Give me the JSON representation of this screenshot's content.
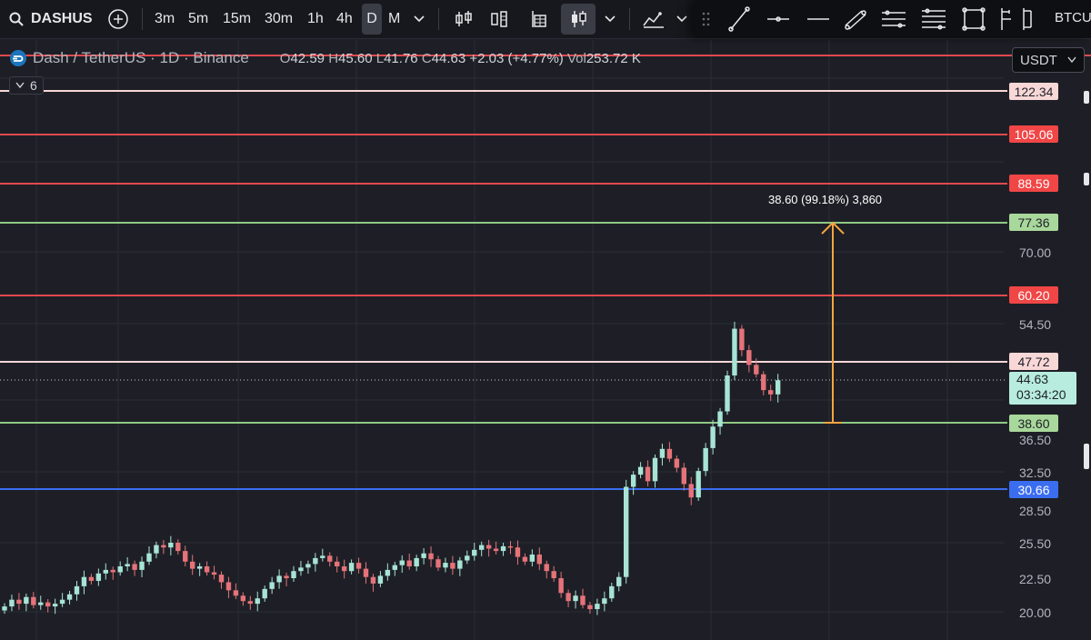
{
  "toolbar": {
    "symbol": "DASHUS",
    "timeframes": [
      "3m",
      "5m",
      "15m",
      "30m",
      "1h",
      "4h",
      "D",
      "M"
    ],
    "active_timeframe": "D",
    "right_text": "BTCU"
  },
  "legend": {
    "title": "Dash / TetherUS · 1D · Binance",
    "o_label": "O",
    "o": "42.59",
    "h_label": "H",
    "h": "45.60",
    "l_label": "L",
    "l": "41.76",
    "c_label": "C",
    "c": "44.63",
    "change": "+2.03 (+4.77%)",
    "vol_label": "Vol",
    "vol": "253.72 K",
    "indicator_count": "6"
  },
  "currency": "USDT",
  "axis_ticks": [
    "70.00",
    "54.50",
    "36.50",
    "32.50",
    "28.50",
    "25.50",
    "22.50",
    "20.00"
  ],
  "price_lines": [
    {
      "label": "122.34",
      "bg": "#f8d7d7",
      "fg": "#1e1f26",
      "line": "#f8d7d7"
    },
    {
      "label": "105.06",
      "bg": "#f04646",
      "fg": "#ffffff",
      "line": "#e04a4f"
    },
    {
      "label": "88.59",
      "bg": "#f04646",
      "fg": "#ffffff",
      "line": "#e04a4f"
    },
    {
      "label": "77.36",
      "bg": "#a8d89b",
      "fg": "#1e1f26",
      "line": "#8fc985"
    },
    {
      "label": "60.20",
      "bg": "#f04646",
      "fg": "#ffffff",
      "line": "#e04a4f"
    },
    {
      "label": "47.72",
      "bg": "#f8d7d7",
      "fg": "#1e1f26",
      "line": "#f8d7d7"
    },
    {
      "label": "38.60",
      "bg": "#a8d89b",
      "fg": "#1e1f26",
      "line": "#8fc985"
    },
    {
      "label": "30.66",
      "bg": "#3b6df0",
      "fg": "#ffffff",
      "line": "#3b6df0"
    }
  ],
  "current_price": {
    "value": "44.63",
    "countdown": "03:34:20",
    "bg": "#b7ecdf"
  },
  "measure": {
    "text": "38.60 (99.18%) 3,860",
    "color": "#f7a541"
  },
  "colors": {
    "up": "#a7e4d5",
    "down": "#e57379"
  },
  "chart_data": {
    "type": "candlestick",
    "x": "daily candles",
    "close_sequence": [
      20.4,
      20.9,
      20.6,
      21.1,
      20.5,
      20.7,
      20.4,
      20.6,
      20.9,
      21.3,
      21.9,
      22.6,
      22.3,
      22.9,
      23.2,
      23.0,
      23.5,
      23.7,
      23.2,
      23.9,
      24.6,
      25.3,
      25.1,
      25.5,
      24.8,
      23.9,
      23.3,
      23.5,
      23.0,
      22.8,
      22.2,
      21.6,
      21.2,
      20.8,
      20.6,
      21.0,
      21.7,
      22.2,
      22.7,
      22.5,
      23.1,
      23.4,
      23.7,
      24.2,
      24.4,
      23.9,
      23.5,
      23.1,
      23.8,
      23.3,
      22.6,
      22.1,
      22.7,
      23.2,
      23.6,
      24.0,
      23.5,
      24.2,
      24.6,
      24.1,
      23.4,
      23.8,
      23.3,
      24.0,
      24.4,
      24.9,
      25.3,
      25.0,
      24.8,
      25.2,
      25.1,
      24.3,
      23.9,
      24.5,
      23.7,
      23.1,
      22.5,
      21.4,
      20.8,
      21.2,
      20.5,
      20.2,
      20.6,
      21.0,
      21.9,
      22.6,
      30.9,
      32.2,
      33.1,
      31.5,
      34.2,
      35.3,
      34.1,
      33.0,
      31.2,
      29.8,
      32.6,
      35.4,
      38.1,
      40.2,
      45.4,
      53.6,
      49.8,
      47.2,
      45.6,
      43.2,
      42.6,
      44.6
    ]
  }
}
